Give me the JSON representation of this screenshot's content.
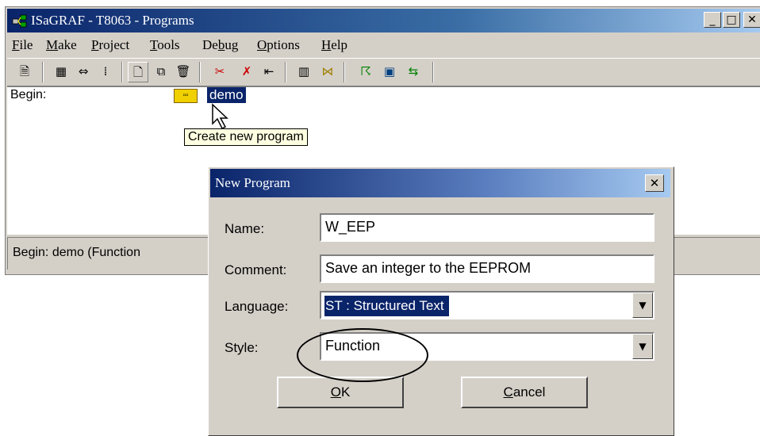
{
  "window": {
    "title": "ISaGRAF - T8063 - Programs",
    "controls": {
      "minimize": "_",
      "maximize": "□",
      "close": "✕"
    }
  },
  "menubar": [
    {
      "label": "File",
      "mnemonic": "F",
      "rest": "ile"
    },
    {
      "label": "Make",
      "mnemonic": "M",
      "rest": "ake"
    },
    {
      "label": "Project",
      "mnemonic": "P",
      "rest": "roject"
    },
    {
      "label": "Tools",
      "mnemonic": "T",
      "rest": "ools"
    },
    {
      "label": "Debug",
      "pre": "De",
      "mnemonic": "b",
      "rest": "ug"
    },
    {
      "label": "Options",
      "mnemonic": "O",
      "rest": "ptions"
    },
    {
      "label": "Help",
      "mnemonic": "H",
      "rest": "elp"
    }
  ],
  "toolbar": {
    "icons": [
      "properties-icon",
      "dictionary-icon",
      "connect-icon",
      "io-icon",
      "new-program-icon",
      "copy-program-icon",
      "delete-program-icon",
      "cut-icon",
      "clear-icon",
      "move-icon",
      "library-icon",
      "link-icon",
      "simulate-icon",
      "monitor-icon",
      "transfer-icon"
    ]
  },
  "client": {
    "section_label": "Begin:",
    "program_name": "demo"
  },
  "tooltip": "Create new program",
  "statusbar": {
    "text": "Begin:  demo  (Function"
  },
  "dialog": {
    "title": "New Program",
    "close": "✕",
    "name_label": "Name:",
    "name_value": "W_EEP",
    "comment_label": "Comment:",
    "comment_value": "Save an integer to the EEPROM",
    "language_label": "Language:",
    "language_value": "ST : Structured Text",
    "style_label": "Style:",
    "style_value": "Function",
    "ok_mnemonic": "O",
    "ok_rest": "K",
    "cancel_mnemonic": "C",
    "cancel_rest": "ancel",
    "dropdown_arrow": "▼"
  },
  "colors": {
    "titlebar": "#0a246a",
    "face": "#d4d0c8",
    "selection": "#0a246a",
    "tooltip": "#ffffe1"
  }
}
